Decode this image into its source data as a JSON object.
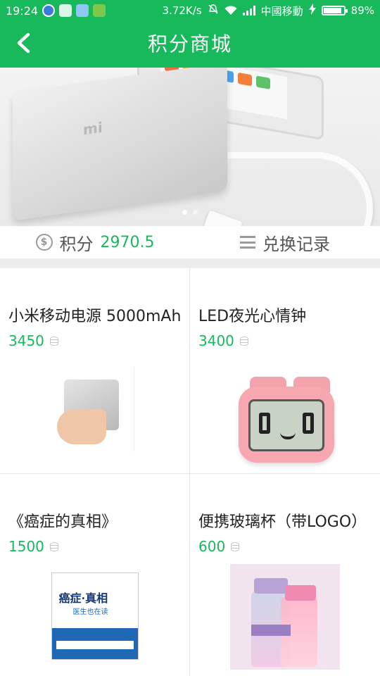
{
  "status_bar": {
    "time": "19:24",
    "speed": "3.72K/s",
    "carrier": "中國移動",
    "battery": "89%"
  },
  "header": {
    "title": "积分商城"
  },
  "banner": {
    "slide_count": 2,
    "active_slide": 1
  },
  "points_bar": {
    "points_label": "积分",
    "points_value": "2970.5",
    "records_label": "兑换记录"
  },
  "colors": {
    "accent": "#17b95a",
    "background": "#ececec"
  },
  "products": [
    {
      "title": "小米移动电源 5000mAh",
      "price": "3450",
      "image": "power-bank-image"
    },
    {
      "title": "LED夜光心情钟",
      "price": "3400",
      "image": "mood-clock-image"
    },
    {
      "title": "《癌症的真相》",
      "price": "1500",
      "image": "book-cover-image",
      "image_text": [
        "癌症·真相",
        "医生也在读"
      ]
    },
    {
      "title": "便携玻璃杯（带LOGO）",
      "price": "600",
      "image": "glass-bottles-image"
    }
  ]
}
